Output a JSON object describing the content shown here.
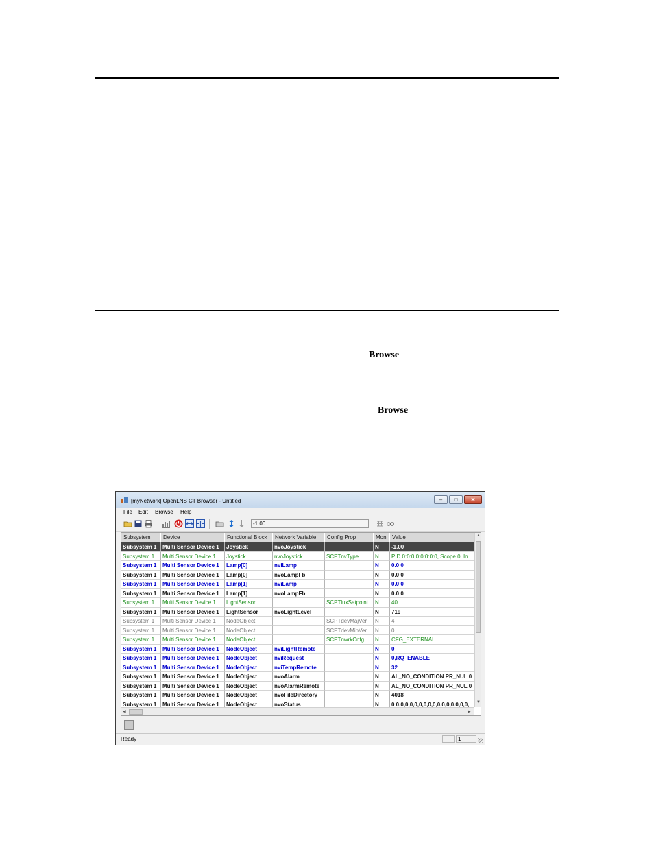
{
  "document": {
    "browse_word_1": "Browse",
    "browse_word_2": "Browse"
  },
  "window": {
    "title": "[myNetwork] OpenLNS CT Browser - Untitled",
    "controls": {
      "minimize": "–",
      "maximize": "□",
      "close": "✕"
    },
    "menu": [
      "File",
      "Edit",
      "Browse",
      "Help"
    ],
    "toolbar": {
      "value_field": "-1.00",
      "icons": [
        "open-icon",
        "save-icon",
        "print-icon",
        "chart-icon",
        "power-icon",
        "expand-columns-icon",
        "collapse-columns-icon",
        "folder-icon",
        "sort-updown-icon",
        "sort-down-icon",
        "grid-icon",
        "glasses-icon"
      ]
    },
    "columns": [
      "Subsystem",
      "Device",
      "Functional Block",
      "Network Variable",
      "Config Prop",
      "Mon",
      "Value"
    ],
    "rows": [
      {
        "style": "selected",
        "cells": [
          "Subsystem 1",
          "Multi Sensor Device 1",
          "Joystick",
          "nvoJoystick",
          "",
          "N",
          "-1.00"
        ]
      },
      {
        "style": "green",
        "cells": [
          "Subsystem 1",
          "Multi Sensor Device 1",
          "Joystick",
          "nvoJoystick",
          "SCPTnvType",
          "N",
          "PID 0:0:0:0:0:0:0:0, Scope 0, In"
        ]
      },
      {
        "style": "blue",
        "cells": [
          "Subsystem 1",
          "Multi Sensor Device 1",
          "Lamp[0]",
          "nviLamp",
          "",
          "N",
          "0.0 0"
        ]
      },
      {
        "style": "black",
        "cells": [
          "Subsystem 1",
          "Multi Sensor Device 1",
          "Lamp[0]",
          "nvoLampFb",
          "",
          "N",
          "0.0 0"
        ]
      },
      {
        "style": "blue",
        "cells": [
          "Subsystem 1",
          "Multi Sensor Device 1",
          "Lamp[1]",
          "nviLamp",
          "",
          "N",
          "0.0 0"
        ]
      },
      {
        "style": "black",
        "cells": [
          "Subsystem 1",
          "Multi Sensor Device 1",
          "Lamp[1]",
          "nvoLampFb",
          "",
          "N",
          "0.0 0"
        ]
      },
      {
        "style": "green",
        "cells": [
          "Subsystem 1",
          "Multi Sensor Device 1",
          "LightSensor",
          "",
          "SCPTluxSetpoint",
          "N",
          "40"
        ]
      },
      {
        "style": "black",
        "cells": [
          "Subsystem 1",
          "Multi Sensor Device 1",
          "LightSensor",
          "nvoLightLevel",
          "",
          "N",
          "719"
        ]
      },
      {
        "style": "gray",
        "cells": [
          "Subsystem 1",
          "Multi Sensor Device 1",
          "NodeObject",
          "",
          "SCPTdevMajVer",
          "N",
          "4"
        ]
      },
      {
        "style": "gray",
        "cells": [
          "Subsystem 1",
          "Multi Sensor Device 1",
          "NodeObject",
          "",
          "SCPTdevMinVer",
          "N",
          "0"
        ]
      },
      {
        "style": "green",
        "cells": [
          "Subsystem 1",
          "Multi Sensor Device 1",
          "NodeObject",
          "",
          "SCPTnwrkCnfg",
          "N",
          "CFG_EXTERNAL"
        ]
      },
      {
        "style": "blue",
        "cells": [
          "Subsystem 1",
          "Multi Sensor Device 1",
          "NodeObject",
          "nviLightRemote",
          "",
          "N",
          "0"
        ]
      },
      {
        "style": "blue",
        "cells": [
          "Subsystem 1",
          "Multi Sensor Device 1",
          "NodeObject",
          "nviRequest",
          "",
          "N",
          "0,RQ_ENABLE"
        ]
      },
      {
        "style": "blue",
        "cells": [
          "Subsystem 1",
          "Multi Sensor Device 1",
          "NodeObject",
          "nviTempRemote",
          "",
          "N",
          "32"
        ]
      },
      {
        "style": "black",
        "cells": [
          "Subsystem 1",
          "Multi Sensor Device 1",
          "NodeObject",
          "nvoAlarm",
          "",
          "N",
          "AL_NO_CONDITION PR_NUL 0"
        ]
      },
      {
        "style": "black",
        "cells": [
          "Subsystem 1",
          "Multi Sensor Device 1",
          "NodeObject",
          "nvoAlarmRemote",
          "",
          "N",
          "AL_NO_CONDITION PR_NUL 0"
        ]
      },
      {
        "style": "black",
        "cells": [
          "Subsystem 1",
          "Multi Sensor Device 1",
          "NodeObject",
          "nvoFileDirectory",
          "",
          "N",
          "4018"
        ]
      },
      {
        "style": "black",
        "cells": [
          "Subsystem 1",
          "Multi Sensor Device 1",
          "NodeObject",
          "nvoStatus",
          "",
          "N",
          "0 0,0,0,0,0,0,0,0,0,0,0,0,0,0,0,0,"
        ]
      }
    ],
    "status": {
      "text": "Ready",
      "pane_value": "1"
    },
    "colors": {
      "selected_row": "#454545",
      "blue_text": "#0000cc",
      "green_text": "#1f8f1f",
      "gray_text": "#7a7a7a"
    }
  }
}
